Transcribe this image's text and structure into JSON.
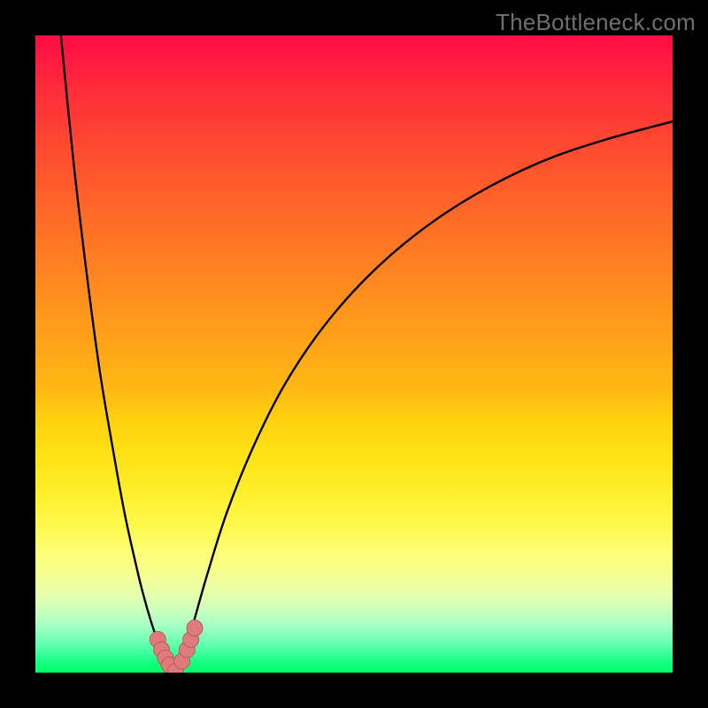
{
  "watermark": {
    "text": "TheBottleneck.com"
  },
  "colors": {
    "frame": "#000000",
    "curve_stroke": "#000000",
    "dot_fill": "#e07b7b",
    "dot_stroke": "#b85a5a"
  },
  "chart_data": {
    "type": "line",
    "title": "",
    "xlabel": "",
    "ylabel": "",
    "xlim": [
      0,
      100
    ],
    "ylim": [
      0,
      100
    ],
    "note": "Axes are unlabeled; values are estimated from pixel positions on a 0–100 scale. y=0 is the bottom green edge, y=100 the top.",
    "series": [
      {
        "name": "left-branch",
        "x": [
          4,
          6,
          8,
          10,
          12,
          14,
          16,
          17,
          18,
          19,
          20,
          20.5,
          21,
          21.5,
          22
        ],
        "y": [
          100,
          80,
          63,
          48,
          36,
          25,
          16,
          12,
          8.5,
          5.5,
          3.2,
          2.2,
          1.4,
          0.6,
          0
        ]
      },
      {
        "name": "right-branch",
        "x": [
          22,
          22.5,
          23,
          24,
          25,
          27,
          30,
          34,
          39,
          45,
          52,
          60,
          69,
          79,
          89,
          100
        ],
        "y": [
          0,
          0.9,
          2.1,
          5,
          8.5,
          15.5,
          25,
          35,
          45,
          54,
          62,
          69,
          75,
          80,
          83.5,
          86.5
        ]
      },
      {
        "name": "highlight-dots",
        "x": [
          19.2,
          19.8,
          20.4,
          21.0,
          22.0,
          23.0,
          23.8,
          24.4,
          25.0
        ],
        "y": [
          5.2,
          3.6,
          2.3,
          1.2,
          0.2,
          1.8,
          3.6,
          5.2,
          7.0
        ]
      }
    ]
  }
}
